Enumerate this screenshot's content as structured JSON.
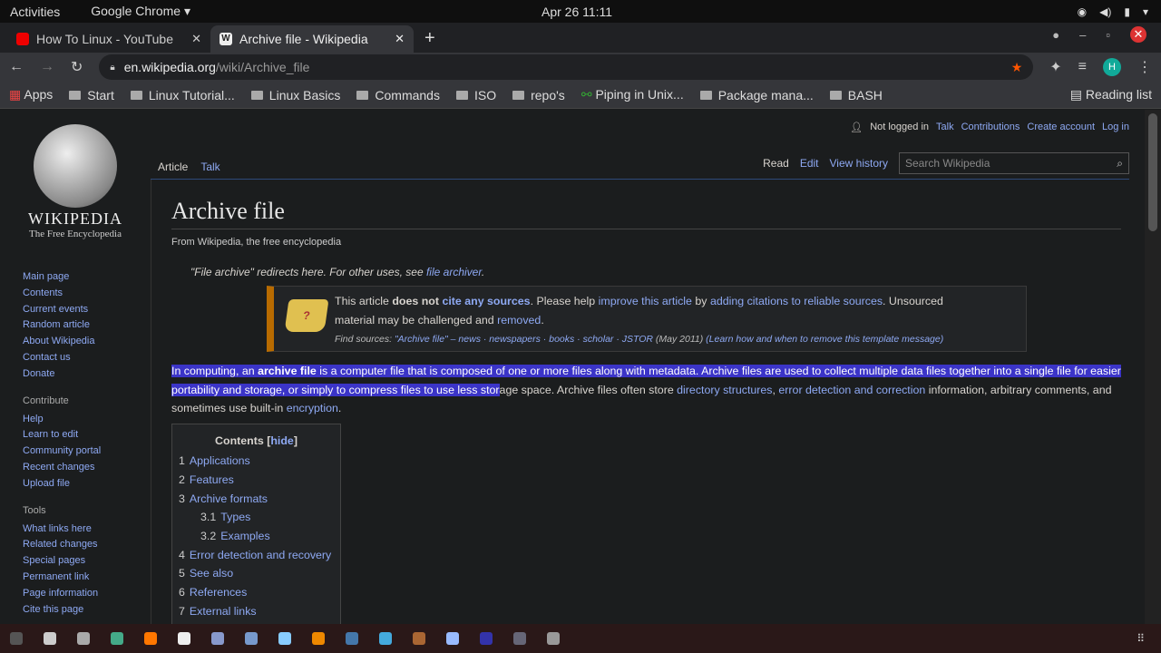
{
  "system": {
    "activities": "Activities",
    "app": "Google Chrome ▾",
    "clock": "Apr 26  11:11"
  },
  "tabs": [
    {
      "title": "How To Linux - YouTube",
      "favicon": "youtube-icon",
      "color": "#e00"
    },
    {
      "title": "Archive file - Wikipedia",
      "favicon": "wikipedia-icon",
      "color": "#eee"
    }
  ],
  "address": {
    "host": "en.wikipedia.org",
    "path": "/wiki/Archive_file"
  },
  "profile_initial": "H",
  "bookmarks": [
    "Start",
    "Linux Tutorial...",
    "Linux Basics",
    "Commands",
    "ISO",
    "repo's",
    "Piping in Unix...",
    "Package mana...",
    "BASH"
  ],
  "bookmarks_apps": "Apps",
  "reading_list": "Reading list",
  "wiki": {
    "wordmark": "WIKIPEDIA",
    "tagline": "The Free Encyclopedia",
    "nav": [
      "Main page",
      "Contents",
      "Current events",
      "Random article",
      "About Wikipedia",
      "Contact us",
      "Donate"
    ],
    "contribute_heading": "Contribute",
    "contribute": [
      "Help",
      "Learn to edit",
      "Community portal",
      "Recent changes",
      "Upload file"
    ],
    "tools_heading": "Tools",
    "tools": [
      "What links here",
      "Related changes",
      "Special pages",
      "Permanent link",
      "Page information",
      "Cite this page"
    ],
    "personal": {
      "status": "Not logged in",
      "links": [
        "Talk",
        "Contributions",
        "Create account",
        "Log in"
      ]
    },
    "tabs_left": [
      "Article",
      "Talk"
    ],
    "tabs_right": [
      "Read",
      "Edit",
      "View history"
    ],
    "search_placeholder": "Search Wikipedia",
    "title": "Archive file",
    "from": "From Wikipedia, the free encyclopedia",
    "hatnote": {
      "text": "\"File archive\" redirects here. For other uses, see ",
      "link": "file archiver",
      "end": "."
    },
    "ambox": {
      "l1a": "This article ",
      "l1b": "does not ",
      "l1c": "cite any sources",
      "l1d": ". Please help ",
      "l1e": "improve this article",
      "l1f": " by ",
      "l1g": "adding citations to reliable sources",
      "l1h": ". Unsourced",
      "l2a": "material may be challenged and ",
      "l2b": "removed",
      "l2c": ".",
      "fs_label": "Find sources: ",
      "fs_links": "\"Archive file\" – news · newspapers · books · scholar · JSTOR",
      "fs_date": " (May 2011) ",
      "fs_learn": "(Learn how and when to remove this template message)"
    },
    "para": {
      "hl1": "In computing, an ",
      "hlb": "archive file",
      "hl2": " is a computer file that is composed of one or more files along with metadata. Archive files are used to collect multiple data files together into a single file for easier portability and storage, or simply to compress files to use less stor",
      "rest1": "age space. Archive files often store ",
      "link1": "directory structures",
      "sep": ", ",
      "link2": "error detection and correction",
      "rest2": " information, arbitrary comments, and sometimes use built-in ",
      "link3": "encryption",
      "end": "."
    },
    "toc": {
      "title": "Contents",
      "hide": "hide",
      "items": [
        {
          "n": "1",
          "t": "Applications"
        },
        {
          "n": "2",
          "t": "Features"
        },
        {
          "n": "3",
          "t": "Archive formats"
        },
        {
          "n": "3.1",
          "t": "Types",
          "sub": true
        },
        {
          "n": "3.2",
          "t": "Examples",
          "sub": true
        },
        {
          "n": "4",
          "t": "Error detection and recovery"
        },
        {
          "n": "5",
          "t": "See also"
        },
        {
          "n": "6",
          "t": "References"
        },
        {
          "n": "7",
          "t": "External links"
        }
      ]
    }
  },
  "dock_colors": [
    "#555",
    "#ccc",
    "#aaa",
    "#4a8",
    "#f70",
    "#eee",
    "#89c",
    "#79c",
    "#8cf",
    "#e80",
    "#47a",
    "#4ad",
    "#a63",
    "#9bf",
    "#33a",
    "#667",
    "#999"
  ]
}
